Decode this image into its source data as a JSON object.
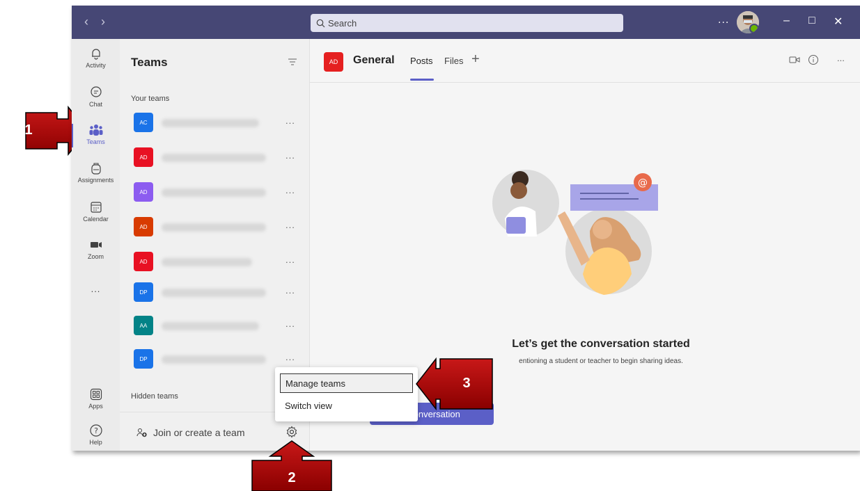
{
  "titlebar": {
    "search_placeholder": "Search",
    "more": "...",
    "back_icon": "chevron-left-icon",
    "forward_icon": "chevron-right-icon"
  },
  "rail": {
    "items": [
      {
        "label": "Activity",
        "icon": "bell-icon"
      },
      {
        "label": "Chat",
        "icon": "chat-icon"
      },
      {
        "label": "Teams",
        "icon": "teams-icon"
      },
      {
        "label": "Assignments",
        "icon": "backpack-icon"
      },
      {
        "label": "Calendar",
        "icon": "calendar-icon"
      },
      {
        "label": "Zoom",
        "icon": "video-icon"
      },
      {
        "label": "...",
        "icon": "more-icon"
      },
      {
        "label": "Apps",
        "icon": "apps-icon"
      },
      {
        "label": "Help",
        "icon": "help-icon"
      }
    ]
  },
  "panel": {
    "title": "Teams",
    "your_teams_label": "Your teams",
    "teams": [
      {
        "initials": "AC",
        "color": "#1a73e8"
      },
      {
        "initials": "AD",
        "color": "#e81123"
      },
      {
        "initials": "AD",
        "color": "#8c5cf0"
      },
      {
        "initials": "AD",
        "color": "#d83b01"
      },
      {
        "initials": "AD",
        "color": "#e81123"
      },
      {
        "initials": "DP",
        "color": "#1a73e8"
      },
      {
        "initials": "AA",
        "color": "#038387"
      },
      {
        "initials": "DP",
        "color": "#1a73e8"
      }
    ],
    "row_more": "...",
    "hidden_teams_label": "Hidden teams",
    "join_label": "Join or create a team"
  },
  "channel": {
    "avatar": "AD",
    "title": "General",
    "tabs": [
      "Posts",
      "Files"
    ],
    "add_tab": "+",
    "more": "..."
  },
  "empty_state": {
    "title": "Let’s get the conversation started",
    "subtitle": "entioning a student or teacher to begin sharing ideas.",
    "button": "r conversation"
  },
  "context_menu": {
    "items": [
      "Manage teams",
      "Switch view"
    ]
  },
  "callouts": [
    "1",
    "2",
    "3"
  ],
  "colors": {
    "titlebar": "#464775",
    "accent": "#5b5fc7",
    "callout": "#c00000"
  }
}
